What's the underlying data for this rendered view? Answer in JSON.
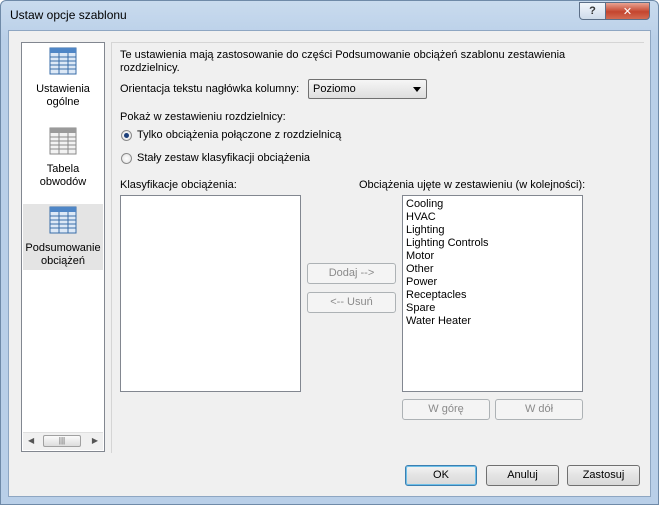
{
  "window": {
    "title": "Ustaw opcje szablonu",
    "help_label": "?",
    "close_label": "✕"
  },
  "sidebar": {
    "items": [
      {
        "label": "Ustawienia ogólne",
        "icon": "general-settings-icon",
        "selected": false
      },
      {
        "label": "Tabela obwodów",
        "icon": "circuit-table-icon",
        "selected": false
      },
      {
        "label": "Podsumowanie obciążeń",
        "icon": "load-summary-icon",
        "selected": true
      }
    ],
    "scroll_left": "◀",
    "scroll_thumb": "|||",
    "scroll_right": "▶"
  },
  "main": {
    "description": "Te ustawienia mają zastosowanie do części Podsumowanie obciążeń szablonu zestawienia",
    "description_line2": "rozdzielnicy.",
    "orientation_label": "Orientacja tekstu nagłówka kolumny:",
    "orientation_value": "Poziomo",
    "show_label": "Pokaż w zestawieniu rozdzielnicy:",
    "radio_connected": "Tylko obciążenia połączone z rozdzielnicą",
    "radio_fixed": "Stały zestaw klasyfikacji obciążenia",
    "classifications_label": "Klasyfikacje obciążenia:",
    "included_label": "Obciążenia ujęte w zestawieniu (w kolejności):",
    "classifications": [],
    "included": [
      "Cooling",
      "HVAC",
      "Lighting",
      "Lighting Controls",
      "Motor",
      "Other",
      "Power",
      "Receptacles",
      "Spare",
      "Water Heater"
    ],
    "add_button": "Dodaj -->",
    "remove_button": "<-- Usuń",
    "up_button": "W górę",
    "down_button": "W dół"
  },
  "footer": {
    "ok": "OK",
    "cancel": "Anuluj",
    "apply": "Zastosuj"
  },
  "colors": {
    "selection_bg": "#e4e4e4",
    "icon_blue": "#4f86c6"
  }
}
